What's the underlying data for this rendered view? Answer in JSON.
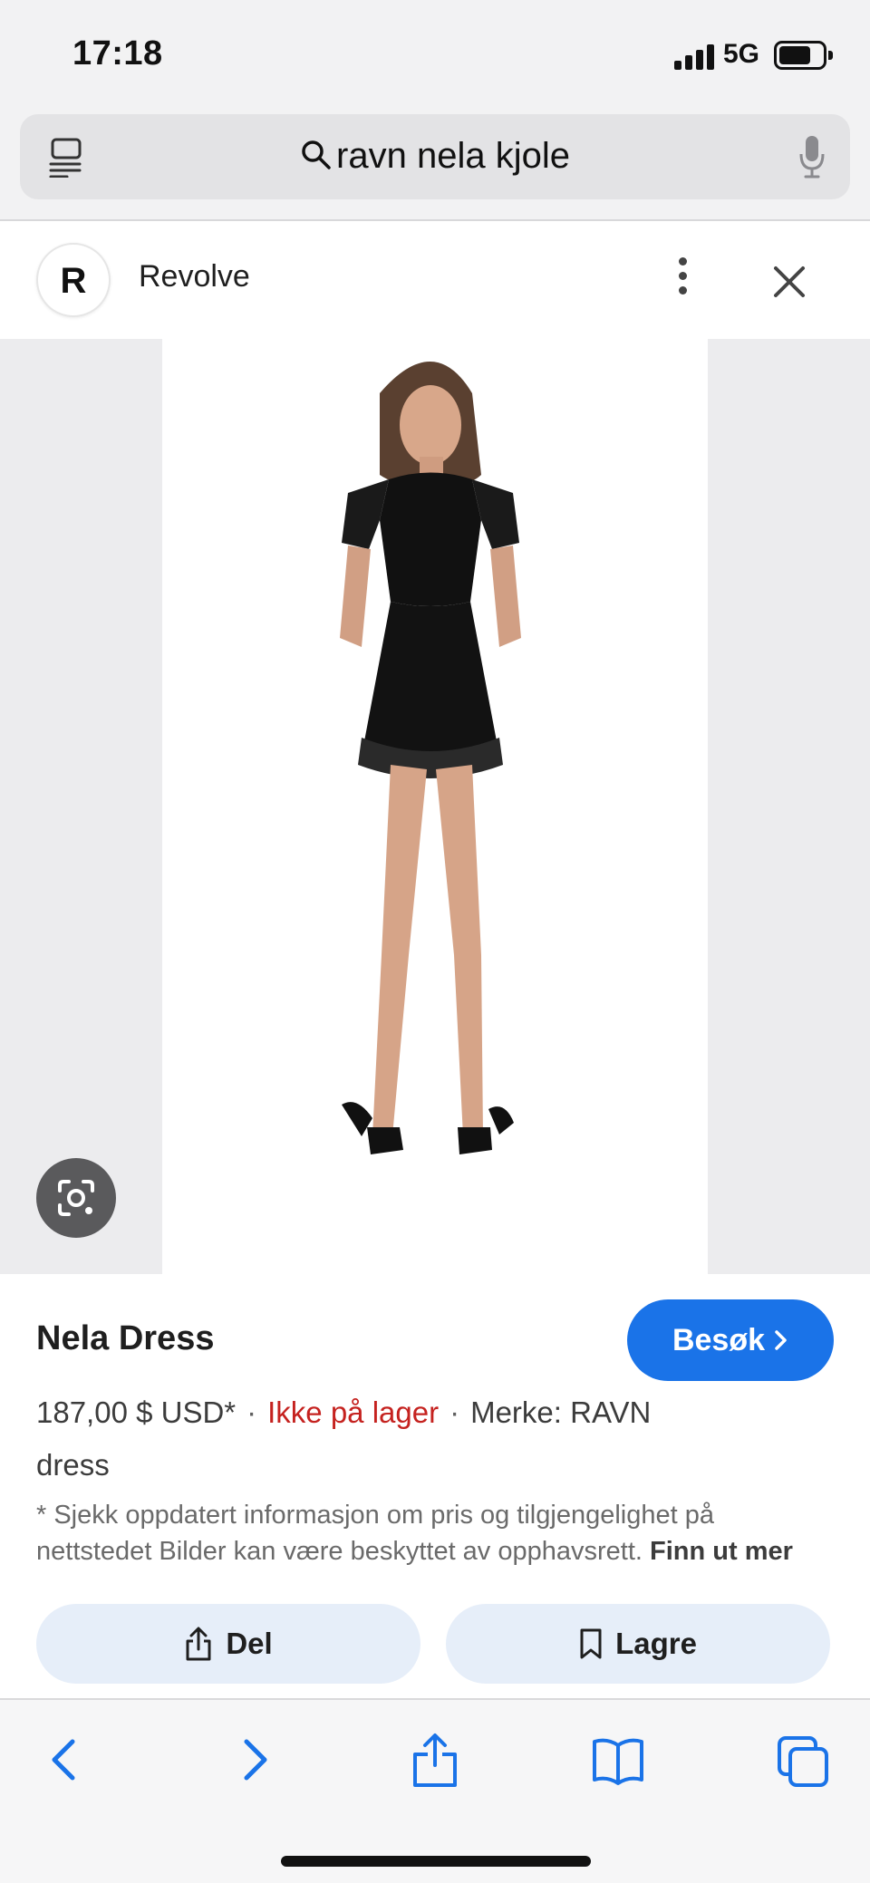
{
  "status_bar": {
    "time": "17:18",
    "network": "5G"
  },
  "search": {
    "query": "ravn nela kjole"
  },
  "source": {
    "logo_letter": "R",
    "name": "Revolve"
  },
  "product": {
    "title": "Nela Dress",
    "visit_label": "Besøk",
    "price": "187,00 $ USD*",
    "stock_status": "Ikke på lager",
    "brand": "Merke: RAVN",
    "description": "dress",
    "disclaimer": "* Sjekk oppdatert informasjon om pris og tilgjengelighet på nettstedet Bilder kan være beskyttet av opphavsrett.",
    "learn_more": "Finn ut mer",
    "separator": "·"
  },
  "actions": {
    "share_label": "Del",
    "save_label": "Lagre"
  },
  "colors": {
    "accent": "#1a73e8",
    "out_of_stock": "#c5221f",
    "chip_bg": "#e6eef9"
  },
  "toolbar": {
    "icons": [
      "back-icon",
      "forward-icon",
      "share-icon",
      "bookmarks-icon",
      "tabs-icon"
    ]
  }
}
